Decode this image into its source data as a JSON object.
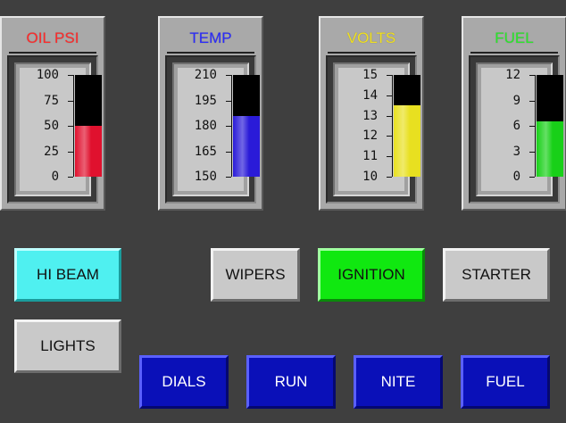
{
  "gauges": [
    {
      "id": "oil",
      "title": "OIL PSI",
      "title_color": "#ff2a2a",
      "ticks": [
        "100",
        "75",
        "50",
        "25",
        "0"
      ],
      "min": 0,
      "max": 100,
      "value": 50,
      "fill_color": "#e0112e"
    },
    {
      "id": "temp",
      "title": "TEMP",
      "title_color": "#2a2aff",
      "ticks": [
        "210",
        "195",
        "180",
        "165",
        "150"
      ],
      "min": 150,
      "max": 210,
      "value": 186,
      "fill_color": "#2a1bd8"
    },
    {
      "id": "volts",
      "title": "VOLTS",
      "title_color": "#f0e020",
      "ticks": [
        "15",
        "14",
        "13",
        "12",
        "11",
        "10"
      ],
      "min": 10,
      "max": 15,
      "value": 13.5,
      "fill_color": "#e8e020"
    },
    {
      "id": "fuel",
      "title": "FUEL",
      "title_color": "#2ae82a",
      "ticks": [
        "12",
        "9",
        "6",
        "3",
        "0"
      ],
      "min": 0,
      "max": 12,
      "value": 6.5,
      "fill_color": "#18d018"
    }
  ],
  "buttons": {
    "hi_beam": "HI BEAM",
    "wipers": "WIPERS",
    "ignition": "IGNITION",
    "starter": "STARTER",
    "lights": "LIGHTS",
    "dials": "DIALS",
    "run": "RUN",
    "nite": "NITE",
    "fuel": "FUEL"
  }
}
